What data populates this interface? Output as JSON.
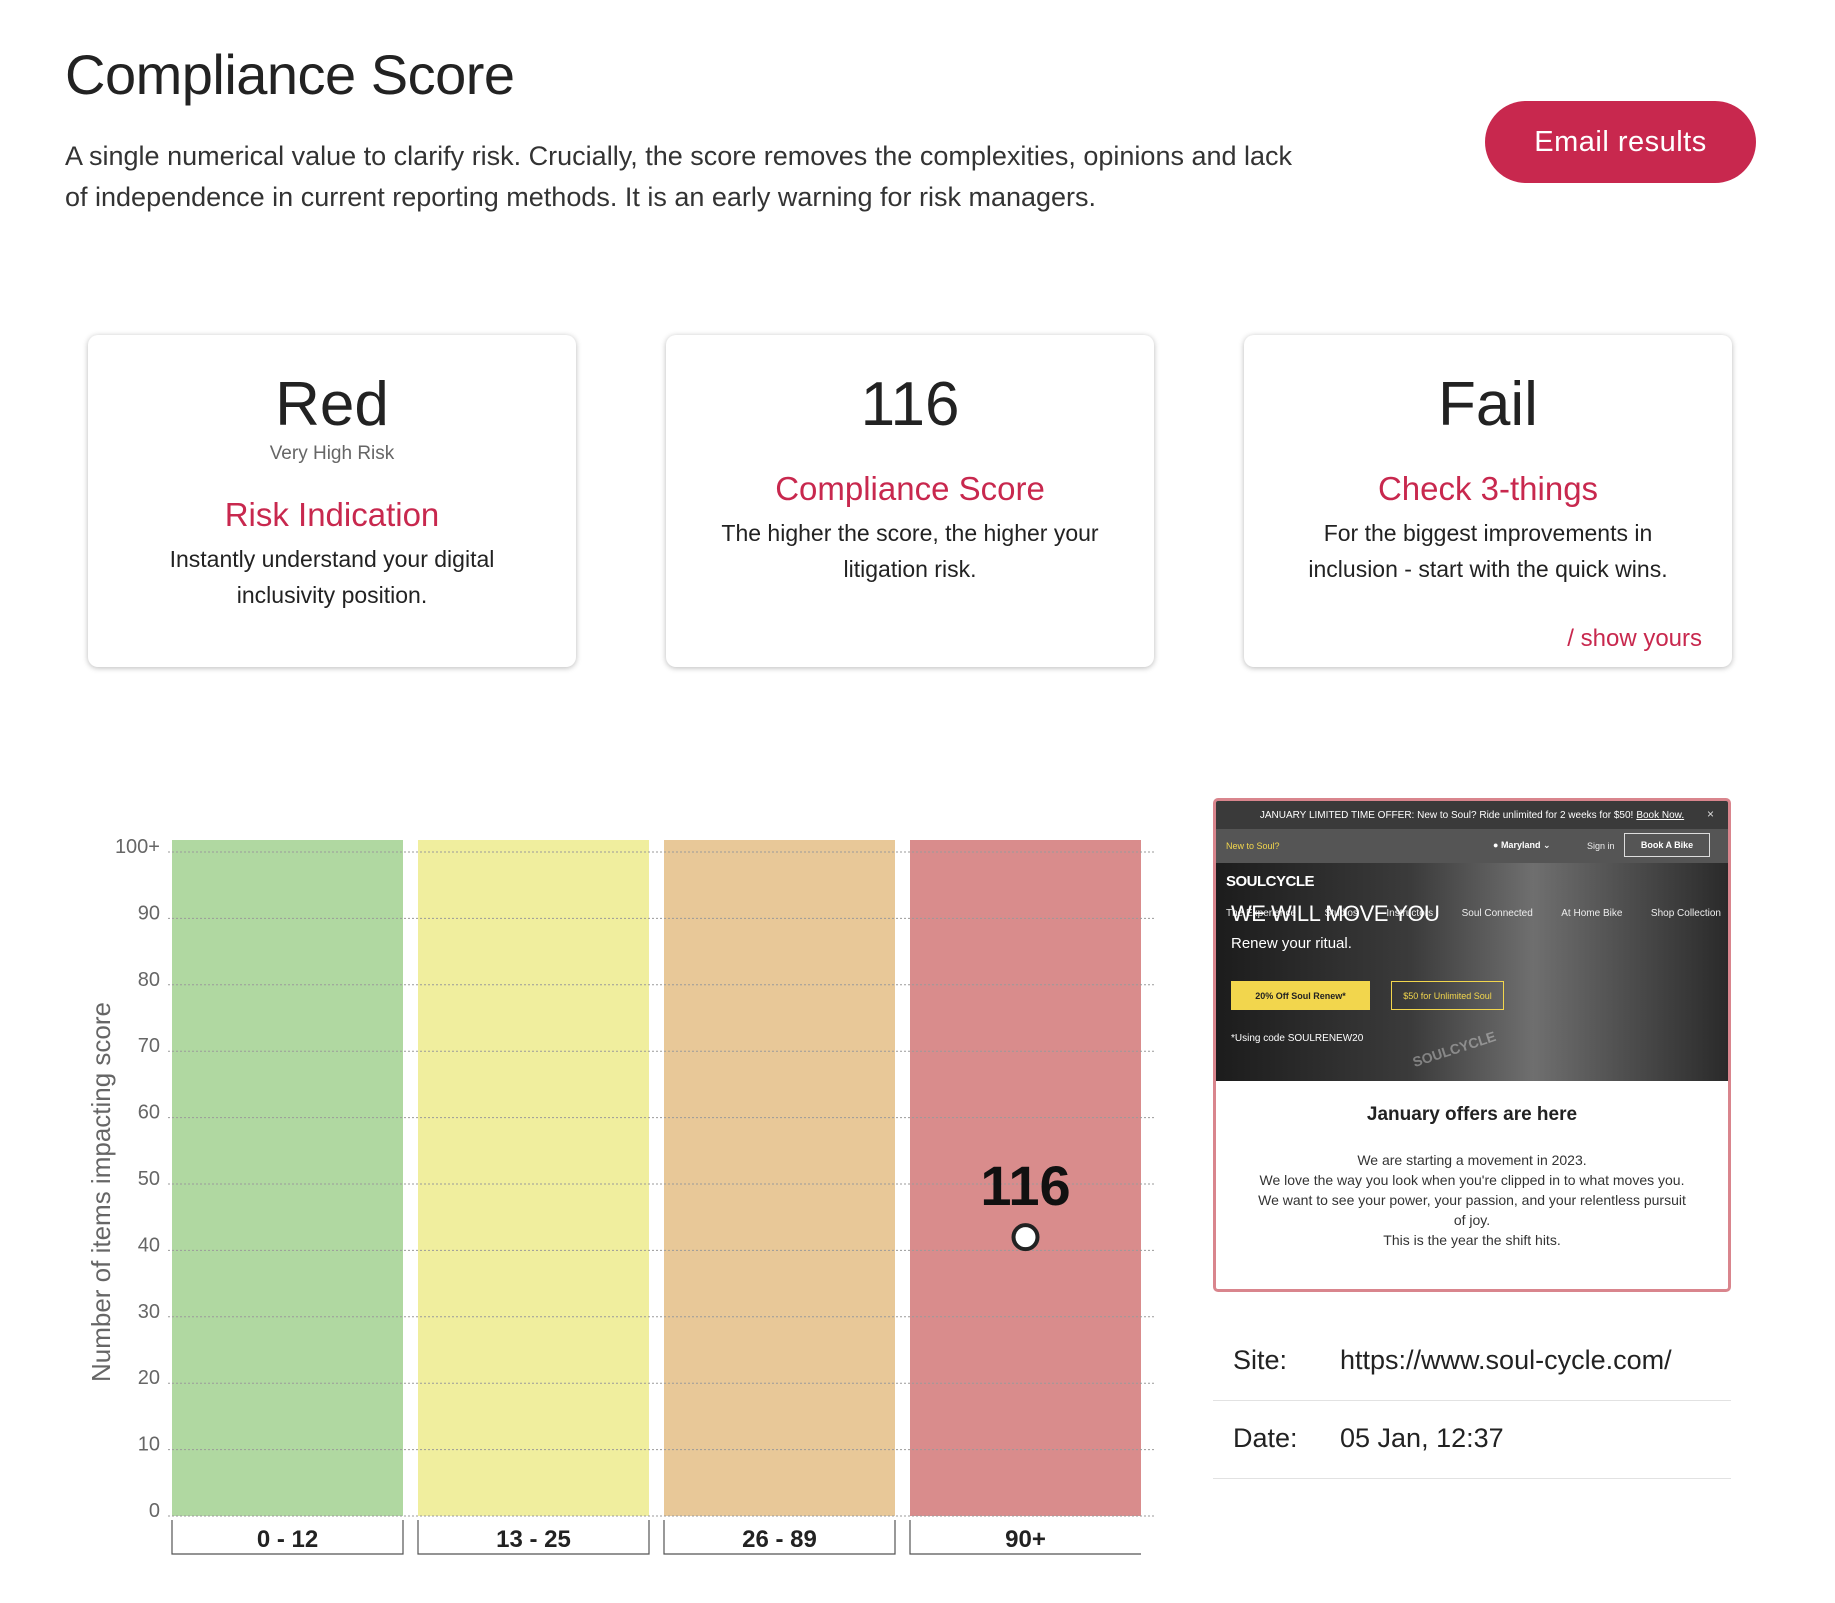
{
  "header": {
    "title": "Compliance Score",
    "description": "A single numerical value to clarify risk. Crucially, the score removes the complexities, opinions and lack of independence in current reporting methods. It is an early warning for risk managers.",
    "email_button": "Email results",
    "accent_color": "#c8284e"
  },
  "cards": [
    {
      "big": "Red",
      "sub": "Very High Risk",
      "heading": "Risk Indication",
      "desc": "Instantly understand your digital inclusivity position."
    },
    {
      "big": "116",
      "heading": "Compliance Score",
      "desc": "The higher the score, the higher your litigation risk."
    },
    {
      "big": "Fail",
      "heading": "Check 3-things",
      "desc": "For the biggest improvements in inclusion - start with the quick wins.",
      "link": "/ show yours"
    }
  ],
  "chart_data": {
    "type": "bar",
    "ylabel": "Number of items impacting score",
    "ytick_labels": [
      "0",
      "10",
      "20",
      "30",
      "40",
      "50",
      "60",
      "70",
      "80",
      "90",
      "100+"
    ],
    "ylim": [
      0,
      100
    ],
    "grid": true,
    "categories": [
      "0 - 12",
      "13 - 25",
      "26 - 89",
      "90+"
    ],
    "values": [
      100,
      100,
      100,
      100
    ],
    "band_colors": [
      "#b0d8a1",
      "#f0ee9e",
      "#e8c898",
      "#d98c8c"
    ],
    "marker": {
      "label": "116",
      "category": "90+",
      "y": 42
    }
  },
  "preview": {
    "banner": "JANUARY LIMITED TIME OFFER: New to Soul? Ride unlimited for 2 weeks for $50!",
    "banner_link": "Book Now.",
    "close": "×",
    "nav_new": "New to Soul?",
    "nav_location": "Maryland",
    "nav_signin": "Sign in",
    "nav_book": "Book A Bike",
    "logo": "SOULCYCLE",
    "menu": [
      "The Experience",
      "Studios",
      "Instructors",
      "Soul Connected",
      "At Home Bike",
      "Shop Collection"
    ],
    "headline": "WE WILL MOVE YOU",
    "tagline": "Renew your ritual.",
    "btn1": "20% Off Soul Renew*",
    "btn2": "$50 for Unlimited Soul",
    "code": "*Using code SOULRENEW20",
    "watermark": "SOULCYCLE",
    "title": "January offers are here",
    "body": [
      "We are starting a movement in 2023.",
      "We love the way you look when you're clipped in to what moves you.",
      "We want to see your power, your passion, and your relentless pursuit of joy.",
      "This is the year the shift hits."
    ]
  },
  "meta": {
    "site_label": "Site:",
    "site_value": "https://www.soul-cycle.com/",
    "date_label": "Date:",
    "date_value": "05 Jan, 12:37"
  }
}
